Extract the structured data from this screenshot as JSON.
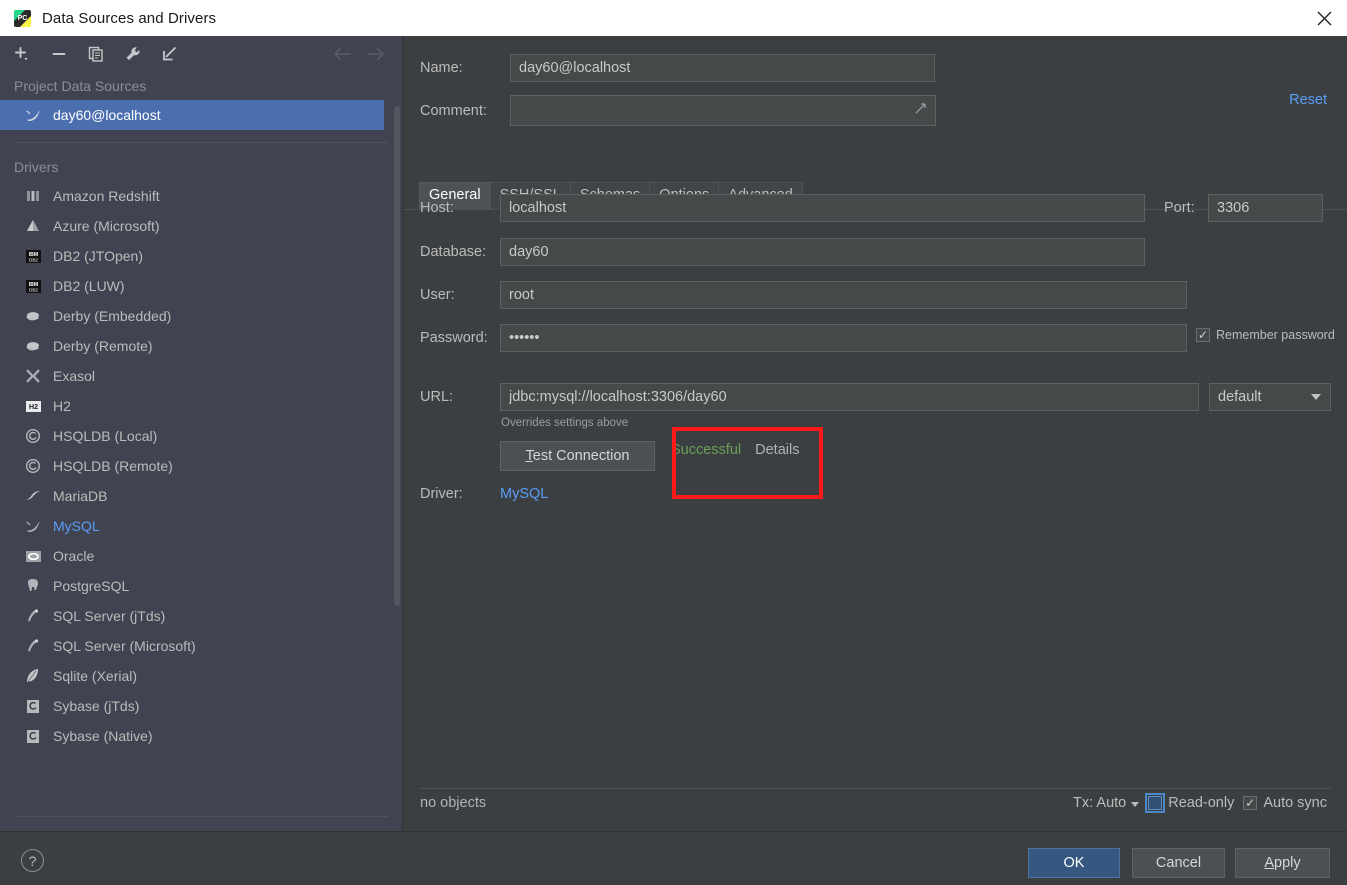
{
  "window": {
    "title": "Data Sources and Drivers",
    "app_icon": "pycharm-icon",
    "close_icon": "close-icon"
  },
  "sidebar": {
    "toolbar": [
      {
        "name": "add-button",
        "icon": "plus-dropdown-icon"
      },
      {
        "name": "remove-button",
        "icon": "minus-icon"
      },
      {
        "name": "duplicate-button",
        "icon": "copy-icon"
      },
      {
        "name": "properties-button",
        "icon": "wrench-icon"
      },
      {
        "name": "import-button",
        "icon": "arrow-into-corner-icon"
      }
    ],
    "nav_back_icon": "arrow-left-icon",
    "nav_forward_icon": "arrow-right-icon",
    "project_section_title": "Project Data Sources",
    "project_items": [
      {
        "label": "day60@localhost",
        "icon": "mysql-dolphin-icon",
        "selected": true
      }
    ],
    "drivers_section_title": "Drivers",
    "drivers": [
      {
        "label": "Amazon Redshift",
        "icon": "redshift-icon"
      },
      {
        "label": "Azure (Microsoft)",
        "icon": "azure-icon"
      },
      {
        "label": "DB2 (JTOpen)",
        "icon": "ibm-db2-icon"
      },
      {
        "label": "DB2 (LUW)",
        "icon": "ibm-db2-icon"
      },
      {
        "label": "Derby (Embedded)",
        "icon": "derby-icon"
      },
      {
        "label": "Derby (Remote)",
        "icon": "derby-icon"
      },
      {
        "label": "Exasol",
        "icon": "exasol-icon"
      },
      {
        "label": "H2",
        "icon": "h2-icon"
      },
      {
        "label": "HSQLDB (Local)",
        "icon": "hsqldb-icon"
      },
      {
        "label": "HSQLDB (Remote)",
        "icon": "hsqldb-icon"
      },
      {
        "label": "MariaDB",
        "icon": "mariadb-icon"
      },
      {
        "label": "MySQL",
        "icon": "mysql-dolphin-icon",
        "highlighted": true
      },
      {
        "label": "Oracle",
        "icon": "oracle-icon"
      },
      {
        "label": "PostgreSQL",
        "icon": "postgresql-elephant-icon"
      },
      {
        "label": "SQL Server (jTds)",
        "icon": "sqlserver-icon"
      },
      {
        "label": "SQL Server (Microsoft)",
        "icon": "sqlserver-icon"
      },
      {
        "label": "Sqlite (Xerial)",
        "icon": "sqlite-feather-icon"
      },
      {
        "label": "Sybase (jTds)",
        "icon": "sybase-icon"
      },
      {
        "label": "Sybase (Native)",
        "icon": "sybase-icon"
      }
    ]
  },
  "panel": {
    "name_label": "Name:",
    "name_value": "day60@localhost",
    "comment_label": "Comment:",
    "comment_value": "",
    "comment_placeholder": "",
    "comment_expand_icon": "expand-arrow-icon",
    "reset_label": "Reset",
    "tabs": [
      {
        "label": "General",
        "active": true
      },
      {
        "label": "SSH/SSL",
        "active": false
      },
      {
        "label": "Schemas",
        "active": false
      },
      {
        "label": "Options",
        "active": false
      },
      {
        "label": "Advanced",
        "active": false
      }
    ],
    "host_label": "Host:",
    "host_value": "localhost",
    "port_label": "Port:",
    "port_value": "3306",
    "database_label": "Database:",
    "database_value": "day60",
    "user_label": "User:",
    "user_value": "root",
    "password_label": "Password:",
    "password_value": "••••••",
    "remember_password_label": "Remember password",
    "remember_password_checked": true,
    "url_label": "URL:",
    "url_value": "jdbc:mysql://localhost:3306/day60",
    "url_scheme_value": "default",
    "url_hint": "Overrides settings above",
    "test_connection_label": "Test Connection",
    "test_status": "Successful",
    "test_details_label": "Details",
    "driver_label": "Driver:",
    "driver_value": "MySQL",
    "status_objects": "no objects",
    "tx_label": "Tx: Auto",
    "readonly_label": "Read-only",
    "readonly_checked": false,
    "autosync_label": "Auto sync",
    "autosync_checked": true
  },
  "annotation": {
    "color": "#ff1a1a",
    "shape": "rectangle"
  },
  "footer": {
    "help_label": "?",
    "ok_label": "OK",
    "cancel_label": "Cancel",
    "apply_label": "Apply"
  },
  "colors": {
    "panel_bg": "#3c3f41",
    "sidebar_bg": "#414450",
    "selection_blue": "#4b6eaf",
    "link_blue": "#589df6",
    "success_green": "#6a9f56",
    "annotation_red": "#ff1a1a",
    "primary_button": "#365880"
  }
}
